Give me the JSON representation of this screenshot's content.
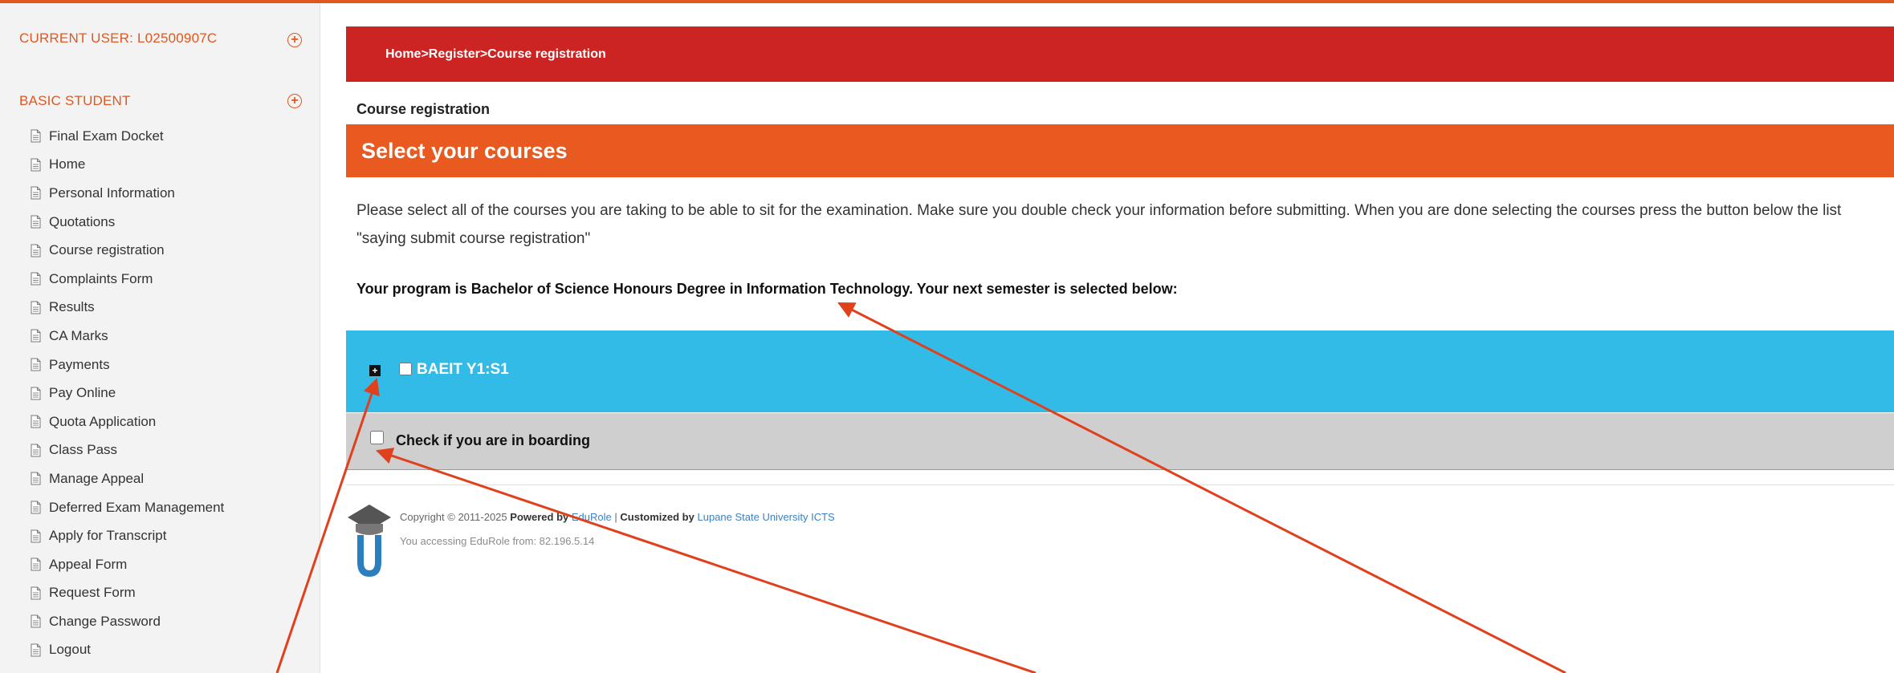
{
  "sidebar": {
    "current_user": "CURRENT USER: L02500907C",
    "section": "BASIC STUDENT",
    "items": [
      {
        "label": "Final Exam Docket"
      },
      {
        "label": "Home"
      },
      {
        "label": "Personal Information"
      },
      {
        "label": "Quotations"
      },
      {
        "label": "Course registration"
      },
      {
        "label": "Complaints Form"
      },
      {
        "label": "Results"
      },
      {
        "label": "CA Marks"
      },
      {
        "label": "Payments"
      },
      {
        "label": "Pay Online"
      },
      {
        "label": "Quota Application"
      },
      {
        "label": "Class Pass"
      },
      {
        "label": "Manage Appeal"
      },
      {
        "label": "Deferred Exam Management"
      },
      {
        "label": "Apply for Transcript"
      },
      {
        "label": "Appeal Form"
      },
      {
        "label": "Request Form"
      },
      {
        "label": "Change Password"
      },
      {
        "label": "Logout"
      }
    ]
  },
  "breadcrumb": "Home>Register>Course registration",
  "page_title": "Course registration",
  "select_header": "Select your courses",
  "instructions": "Please select all of the courses you are taking to be able to sit for the examination. Make sure you double check your information before submitting. When you are done selecting the courses press the button below the list \"saying submit course registration\"",
  "program_text": "Your program is Bachelor of Science Honours Degree in Information Technology. Your next semester is selected below:",
  "semester": {
    "label": "BAEIT Y1:S1",
    "expander": "+",
    "checked": false
  },
  "boarding": {
    "label": "Check if you are in boarding",
    "checked": false
  },
  "footer": {
    "copyright_prefix": "Copyright © 2011-2025",
    "powered_by": "Powered by",
    "powered_link": "EduRole",
    "separator": "|",
    "customized_by": "Customized by",
    "customized_link": "Lupane State University ICTS",
    "access": "You accessing EduRole from: 82.196.5.14"
  },
  "colors": {
    "accent_orange": "#e85a20",
    "breadcrumb_red": "#cc2422",
    "semester_blue": "#33bbe8",
    "boarding_gray": "#cfcfcf",
    "annotation_arrow": "#e0401c"
  },
  "icons": {
    "nav": "document-icon",
    "section_toggle": "plus-circle-icon",
    "logo": "edurole-graduation-cap-logo"
  }
}
